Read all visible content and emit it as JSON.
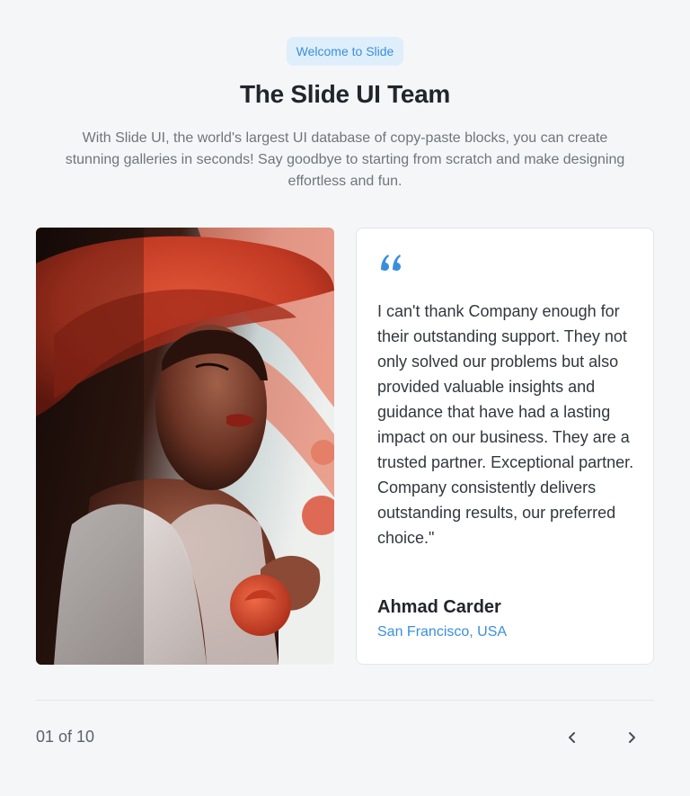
{
  "header": {
    "badge": "Welcome to Slide",
    "title": "The Slide UI Team",
    "subtitle": "With Slide UI, the world's largest UI database of copy-paste blocks, you can create stunning galleries in seconds! Say goodbye to starting from scratch and make designing effortless and fun."
  },
  "testimonial": {
    "quote": "I can't thank Company enough for their outstanding support. They not only solved our problems but also provided valuable insights and guidance that have had a lasting impact on our business. They are a trusted partner. Exceptional partner. Company consistently delivers outstanding results, our preferred choice.\"",
    "author": "Ahmad Carder",
    "location": "San Francisco, USA"
  },
  "pagination": {
    "label": "01 of 10"
  },
  "icons": {
    "quote": "quote-icon",
    "prev": "chevron-left-icon",
    "next": "chevron-right-icon"
  },
  "colors": {
    "accent": "#3a8fdc",
    "badge_bg": "#dfeefb",
    "background": "#f5f6f8"
  }
}
